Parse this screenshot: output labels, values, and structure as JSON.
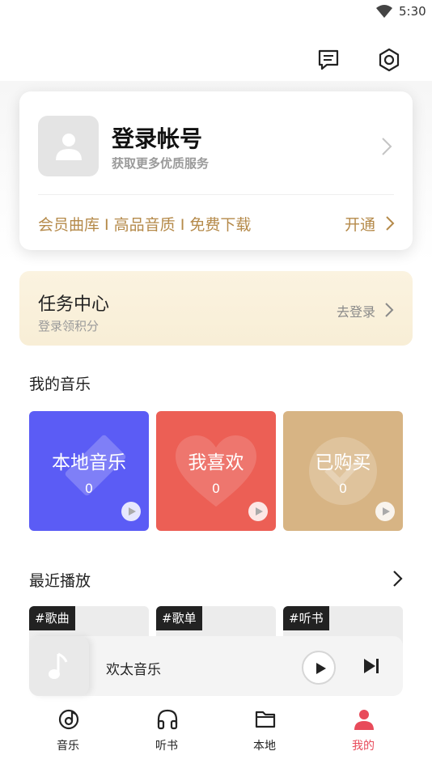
{
  "status_bar": {
    "time": "5:30"
  },
  "login_card": {
    "title": "登录帐号",
    "subtitle": "获取更多优质服务",
    "vip_perks": "会员曲库 I 高品音质 I 免费下载",
    "vip_open": "开通"
  },
  "task_center": {
    "title": "任务中心",
    "subtitle": "登录领积分",
    "action": "去登录"
  },
  "my_music": {
    "title": "我的音乐",
    "tiles": [
      {
        "label": "本地音乐",
        "count": "0",
        "color": "#5b5cf5"
      },
      {
        "label": "我喜欢",
        "count": "0",
        "color": "#ec5f55"
      },
      {
        "label": "已购买",
        "count": "0",
        "color": "#d7b484"
      }
    ]
  },
  "recent": {
    "title": "最近播放",
    "tags": [
      "#歌曲",
      "#歌单",
      "#听书"
    ]
  },
  "player": {
    "title": "欢太音乐"
  },
  "tabbar": {
    "items": [
      {
        "label": "音乐",
        "icon": "music-disc-icon"
      },
      {
        "label": "听书",
        "icon": "headphones-icon"
      },
      {
        "label": "本地",
        "icon": "folder-icon"
      },
      {
        "label": "我的",
        "icon": "person-icon"
      }
    ],
    "active_color": "#e84b5a"
  }
}
